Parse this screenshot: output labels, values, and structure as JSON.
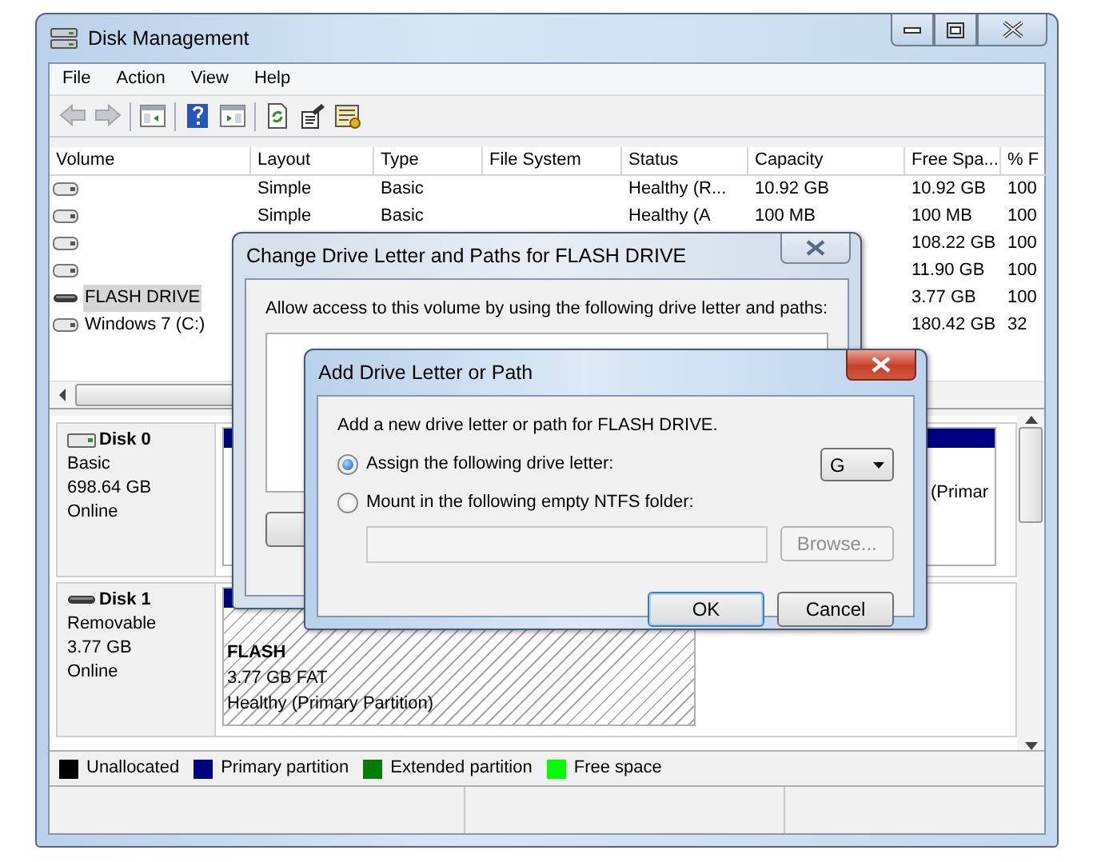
{
  "window": {
    "title": "Disk Management"
  },
  "menu": [
    {
      "label": "File"
    },
    {
      "label": "Action"
    },
    {
      "label": "View"
    },
    {
      "label": "Help"
    }
  ],
  "toolbar": [
    {
      "kind": "back",
      "disabled": true
    },
    {
      "kind": "forward",
      "disabled": true
    },
    {
      "kind": "separator"
    },
    {
      "kind": "tree",
      "disabled": false
    },
    {
      "kind": "separator"
    },
    {
      "kind": "help",
      "disabled": false
    },
    {
      "kind": "pane",
      "disabled": false
    },
    {
      "kind": "separator"
    },
    {
      "kind": "refresh",
      "disabled": false
    },
    {
      "kind": "properties",
      "disabled": false
    },
    {
      "kind": "settings",
      "disabled": false
    }
  ],
  "table": {
    "columns": [
      {
        "label": "Volume"
      },
      {
        "label": "Layout"
      },
      {
        "label": "Type"
      },
      {
        "label": "File System"
      },
      {
        "label": "Status"
      },
      {
        "label": "Capacity"
      },
      {
        "label": "Free Spa..."
      },
      {
        "label": "% F"
      }
    ],
    "rows": [
      {
        "kind": "fixed",
        "selected": false,
        "layout": "Simple",
        "type": "Basic",
        "status": "Healthy (R...",
        "capacity": "10.92 GB",
        "free_space": "10.92 GB",
        "percent_free": "100"
      },
      {
        "kind": "fixed",
        "selected": false,
        "layout": "Simple",
        "type": "Basic",
        "status": "Healthy (A",
        "capacity": "100 MB",
        "free_space": "100 MB",
        "percent_free": "100"
      },
      {
        "kind": "fixed",
        "selected": false,
        "free_space": "108.22 GB",
        "percent_free": "100"
      },
      {
        "kind": "fixed",
        "selected": false,
        "free_space": "11.90 GB",
        "percent_free": "100"
      },
      {
        "kind": "removable",
        "selected": true,
        "volume": "FLASH DRIVE",
        "free_space": "3.77 GB",
        "percent_free": "100"
      },
      {
        "kind": "fixed",
        "selected": false,
        "volume": "Windows 7 (C:)",
        "free_space": "180.42 GB",
        "percent_free": "32"
      }
    ]
  },
  "disks": [
    {
      "kind": "fixed",
      "name": "Disk 0",
      "type": "Basic",
      "size": "698.64 GB",
      "status": "Online",
      "partitions": [
        {
          "selected": false
        },
        {
          "selected": false,
          "lines": [
            "(Primar"
          ]
        }
      ]
    },
    {
      "kind": "removable",
      "name": "Disk 1",
      "type": "Removable",
      "size": "3.77 GB",
      "status": "Online",
      "partitions": [
        {
          "selected": true,
          "name": "FLASH",
          "lines": [
            "3.77 GB FAT",
            "Healthy (Primary Partition)"
          ]
        }
      ]
    }
  ],
  "legend": [
    {
      "label": "Unallocated",
      "color": "#000000"
    },
    {
      "label": "Primary partition",
      "color": "#000080"
    },
    {
      "label": "Extended partition",
      "color": "#008000"
    },
    {
      "label": "Free space",
      "color": "#00ff00"
    }
  ],
  "change_dialog": {
    "title": "Change Drive Letter and Paths for FLASH DRIVE",
    "prompt": "Allow access to this volume by using the following drive letter and paths:"
  },
  "add_dialog": {
    "title": "Add Drive Letter or Path",
    "prompt": "Add a new drive letter or path for FLASH DRIVE.",
    "options": [
      {
        "kind": "letter",
        "label": "Assign the following drive letter:",
        "selected": true,
        "value": "G"
      },
      {
        "kind": "folder",
        "label": "Mount in the following empty NTFS folder:",
        "selected": false,
        "button": "Browse..."
      }
    ],
    "buttons": [
      {
        "label": "OK",
        "default": true
      },
      {
        "label": "Cancel",
        "default": false
      }
    ]
  }
}
